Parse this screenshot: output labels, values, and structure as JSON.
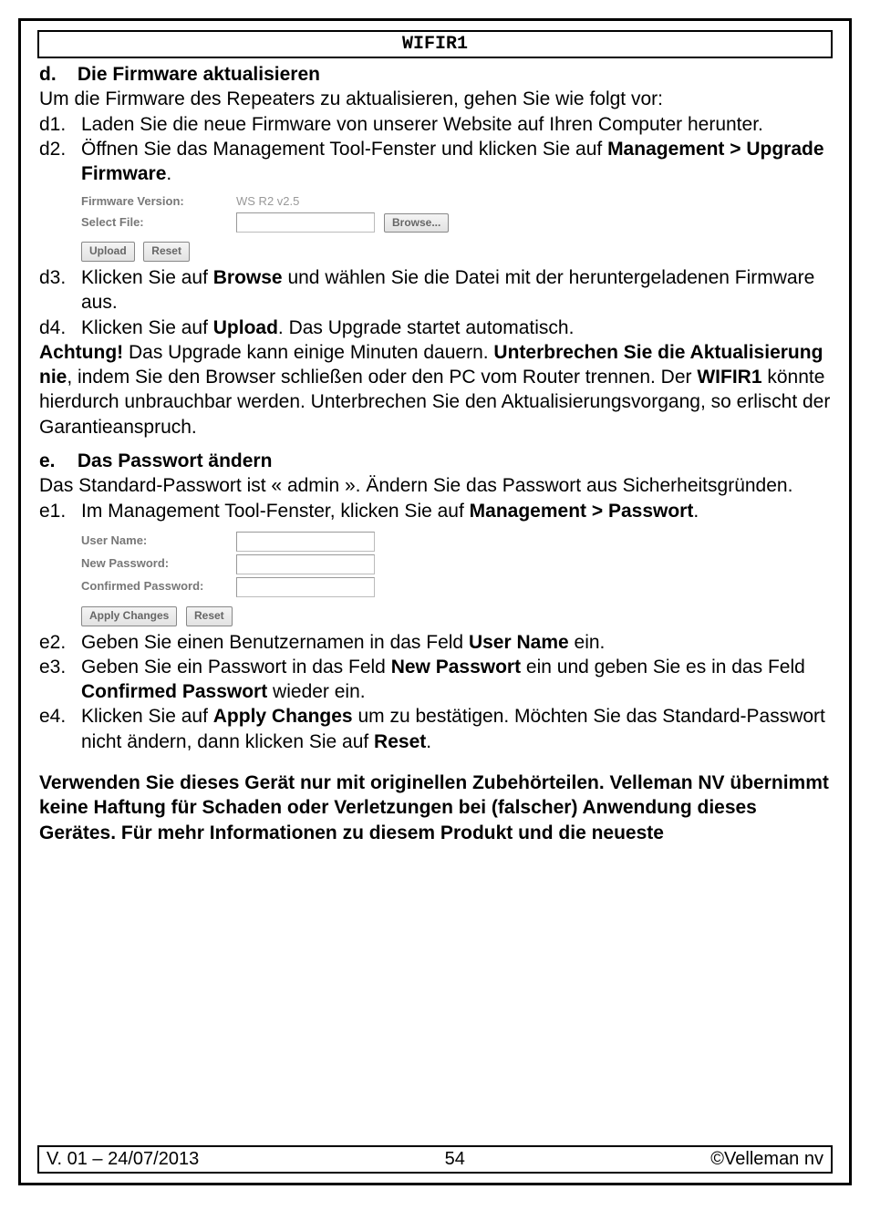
{
  "header": {
    "title": "WIFIR1"
  },
  "sectionD": {
    "letter": "d.",
    "title": "Die Firmware aktualisieren",
    "intro": "Um die Firmware des Repeaters zu aktualisieren, gehen Sie wie folgt vor:",
    "steps": {
      "d1": {
        "num": "d1.",
        "text": "Laden Sie die neue Firmware von unserer Website auf Ihren Computer herunter."
      },
      "d2": {
        "num": "d2.",
        "pre": "Öffnen Sie das Management Tool-Fenster und klicken Sie auf ",
        "bold": "Management > Upgrade Firmware",
        "post": "."
      },
      "d3": {
        "num": "d3.",
        "pre": "Klicken Sie auf ",
        "bold": "Browse",
        "post": " und wählen Sie die Datei mit der heruntergeladenen Firmware aus."
      },
      "d4": {
        "num": "d4.",
        "pre": "Klicken Sie auf ",
        "bold": "Upload",
        "post": ". Das Upgrade startet automatisch."
      }
    },
    "ui": {
      "firmware_version_label": "Firmware Version:",
      "firmware_version_value": "WS R2 v2.5",
      "select_file_label": "Select File:",
      "browse_button": "Browse...",
      "upload_button": "Upload",
      "reset_button": "Reset"
    },
    "warning": {
      "a": "Achtung!",
      "t1": " Das Upgrade kann einige Minuten dauern. ",
      "b1": "Unterbrechen Sie die Aktualisierung nie",
      "t2": ", indem Sie den Browser schließen oder den PC vom Router trennen. Der ",
      "b2": "WIFIR1",
      "t3": " könnte hierdurch unbrauchbar werden. Unterbrechen Sie den Aktualisierungsvorgang, so erlischt der Garantieanspruch."
    }
  },
  "sectionE": {
    "letter": "e.",
    "title": "Das Passwort ändern",
    "intro": "Das Standard-Passwort ist « admin ». Ändern Sie das Passwort aus Sicherheitsgründen.",
    "steps": {
      "e1": {
        "num": "e1.",
        "pre": "Im Management Tool-Fenster, klicken Sie auf ",
        "bold": "Management > Passwort",
        "post": "."
      },
      "e2": {
        "num": "e2.",
        "pre": "Geben Sie einen Benutzernamen in das Feld ",
        "bold": "User Name",
        "post": " ein."
      },
      "e3": {
        "num": "e3.",
        "pre": "Geben Sie ein Passwort in das Feld ",
        "bold1": "New Passwort",
        "mid": " ein und geben Sie es in das Feld ",
        "bold2": "Confirmed Passwort",
        "post": " wieder ein."
      },
      "e4": {
        "num": "e4.",
        "pre": "Klicken Sie auf ",
        "bold1": "Apply Changes",
        "mid": " um zu bestätigen. Möchten Sie das Standard-Passwort nicht ändern, dann klicken Sie auf ",
        "bold2": "Reset",
        "post": "."
      }
    },
    "ui": {
      "user_name_label": "User Name:",
      "new_password_label": "New Password:",
      "confirmed_password_label": "Confirmed Password:",
      "apply_button": "Apply Changes",
      "reset_button": "Reset"
    }
  },
  "disclaimer": "Verwenden Sie dieses Gerät nur mit originellen Zubehörteilen. Velleman NV übernimmt keine Haftung für Schaden oder Verletzungen bei (falscher) Anwendung dieses Gerätes. Für mehr Informationen zu diesem Produkt und die neueste",
  "footer": {
    "left": "V. 01 – 24/07/2013",
    "center": "54",
    "right": "©Velleman nv"
  }
}
